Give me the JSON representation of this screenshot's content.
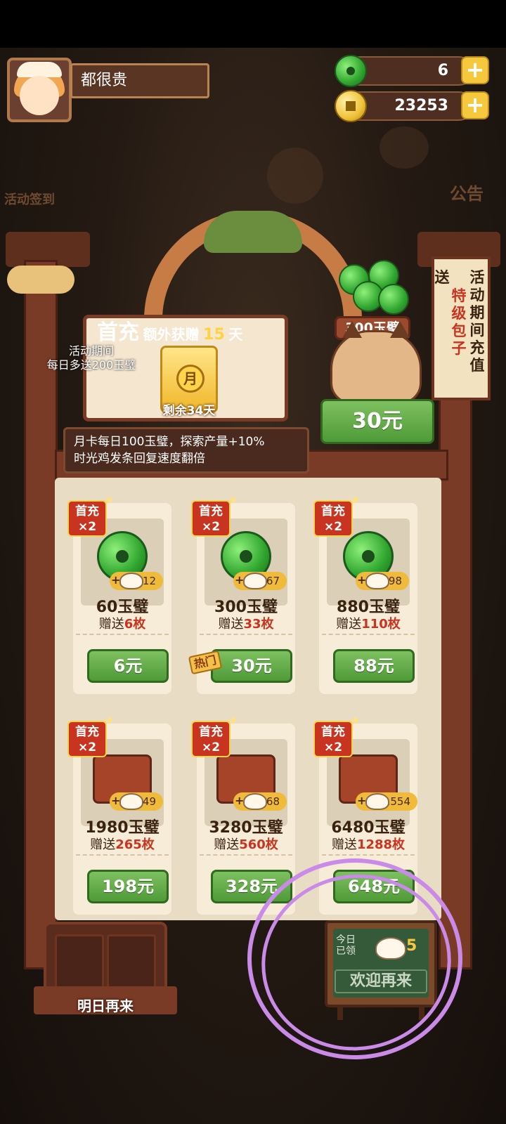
{
  "header": {
    "player_name": "都很贵",
    "jade_count": "6",
    "coin_count": "23253"
  },
  "side_labels": {
    "left_faded": "活动签到",
    "right_faded": "公告"
  },
  "first_recharge": {
    "title_big": "首充",
    "title_mid": "额外获赠",
    "title_num": "15",
    "title_unit": "天",
    "card_char": "月",
    "remaining": "剩余34天",
    "promo_line1": "活动期间",
    "promo_line2": "每日多送200玉璧",
    "desc_line1": "月卡每日100玉璧，探索产量+10%",
    "desc_line2": "时光鸡发条回复速度翻倍"
  },
  "cat_offer": {
    "bowl_label": "300玉璧",
    "price": "30元"
  },
  "side_banner": {
    "col1": "活动期间充值",
    "col2": "特级包子",
    "col3": "送"
  },
  "products": [
    {
      "badge_top": "首充",
      "badge_bottom": "×2",
      "bonus": "12",
      "amount": "60玉璧",
      "gift_prefix": "赠送",
      "gift_num": "6枚",
      "price": "6元"
    },
    {
      "badge_top": "首充",
      "badge_bottom": "×2",
      "bonus": "67",
      "amount": "300玉璧",
      "gift_prefix": "赠送",
      "gift_num": "33枚",
      "price": "30元",
      "tag": "热门"
    },
    {
      "badge_top": "首充",
      "badge_bottom": "×2",
      "bonus": "198",
      "amount": "880玉璧",
      "gift_prefix": "赠送",
      "gift_num": "110枚",
      "price": "88元"
    },
    {
      "badge_top": "首充",
      "badge_bottom": "×2",
      "bonus": "449",
      "amount": "1980玉璧",
      "gift_prefix": "赠送",
      "gift_num": "265枚",
      "price": "198元"
    },
    {
      "badge_top": "首充",
      "badge_bottom": "×2",
      "bonus": "768",
      "amount": "3280玉璧",
      "gift_prefix": "赠送",
      "gift_num": "560枚",
      "price": "328元"
    },
    {
      "badge_top": "首充",
      "badge_bottom": "×2",
      "bonus": "1554",
      "amount": "6480玉璧",
      "gift_prefix": "赠送",
      "gift_num": "1288枚",
      "price": "648元"
    }
  ],
  "bottom": {
    "chest_label": "明日再来",
    "board_line1": "今日",
    "board_line2": "已领",
    "board_count": "5",
    "board_message": "欢迎再来"
  },
  "colors": {
    "accent_green": "#4f9a38",
    "badge_red": "#c8341f",
    "annotation": "#c98ae8"
  }
}
